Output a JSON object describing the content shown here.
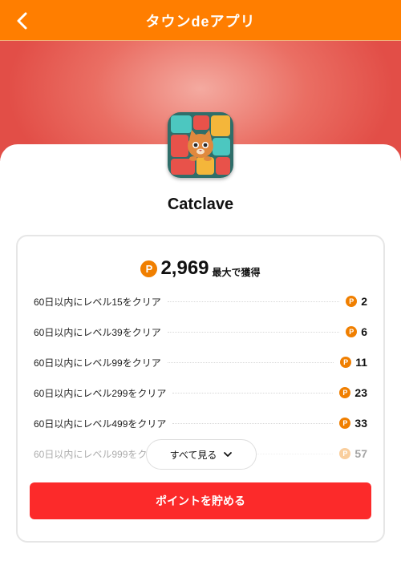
{
  "header": {
    "title": "タウンdeアプリ"
  },
  "app": {
    "name": "Catclave"
  },
  "rewards": {
    "total_value": "2,969",
    "total_label": "最大で獲得",
    "items": [
      {
        "label": "60日以内にレベル15をクリア",
        "points": "2"
      },
      {
        "label": "60日以内にレベル39をクリア",
        "points": "6"
      },
      {
        "label": "60日以内にレベル99をクリア",
        "points": "11"
      },
      {
        "label": "60日以内にレベル299をクリア",
        "points": "23"
      },
      {
        "label": "60日以内にレベル499をクリア",
        "points": "33"
      },
      {
        "label": "60日以内にレベル999をク",
        "points": "57"
      }
    ],
    "see_all_label": "すべて見る"
  },
  "actions": {
    "save_label": "ポイントを貯める"
  },
  "icons": {
    "back": "chevron-left-icon",
    "coin": "point-coin-icon",
    "expand": "chevron-down-icon"
  },
  "colors": {
    "brand": "#ff7e00",
    "hero": "#e24e47",
    "primary_button": "#fc2a2a",
    "coin": "#f07f00"
  }
}
